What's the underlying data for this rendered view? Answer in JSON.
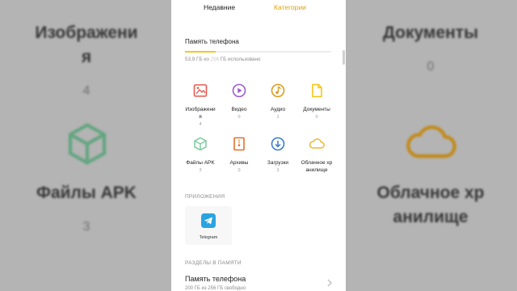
{
  "colors": {
    "accent": "#e0a400",
    "image": "#e85a4f",
    "video": "#9b59d0",
    "audio": "#e09a1a",
    "docs": "#f5c518",
    "apk": "#7bc99b",
    "archive": "#e66f2a",
    "downloads": "#3a7bd5",
    "cloud": "#f2b630",
    "telegram": "#2aa3e0"
  },
  "tabs": {
    "recent": "Недавние",
    "categories": "Категории",
    "active": "categories"
  },
  "storage": {
    "title": "Память телефона",
    "usage_prefix": "53,9 ГБ из",
    "usage_hidden": "256",
    "usage_suffix": "ГБ использовано",
    "used_fraction": 0.21
  },
  "categories": [
    {
      "label": "Изображени\nя",
      "count": "4",
      "icon": "image-icon"
    },
    {
      "label": "Видео",
      "count": "0",
      "icon": "video-icon"
    },
    {
      "label": "Аудио",
      "count": "1",
      "icon": "audio-icon"
    },
    {
      "label": "Документы",
      "count": "0",
      "icon": "document-icon"
    },
    {
      "label": "Файлы APK",
      "count": "3",
      "icon": "apk-icon"
    },
    {
      "label": "Архивы",
      "count": "0",
      "icon": "archive-icon"
    },
    {
      "label": "Загрузки",
      "count": "3",
      "icon": "download-icon"
    },
    {
      "label": "Облачное хр\nанилище",
      "count": "",
      "icon": "cloud-icon"
    }
  ],
  "apps_section": {
    "title": "ПРИЛОЖЕНИЯ",
    "apps": [
      {
        "label": "Telegram",
        "icon": "telegram-icon"
      }
    ]
  },
  "memory_section": {
    "title": "РАЗДЕЛЫ В ПАМЯТИ",
    "item_title": "Память телефона",
    "item_sub": "200 ГБ из 256 ГБ свободно"
  },
  "background": {
    "left_top": {
      "label_l1": "Изображени",
      "label_l2": "я",
      "count": "4"
    },
    "right_top": {
      "label": "Документы",
      "count": "0"
    },
    "left_bottom": {
      "label": "Файлы APK",
      "count": "3"
    },
    "right_bottom": {
      "label_l1": "Облачное хр",
      "label_l2": "анилище"
    }
  }
}
